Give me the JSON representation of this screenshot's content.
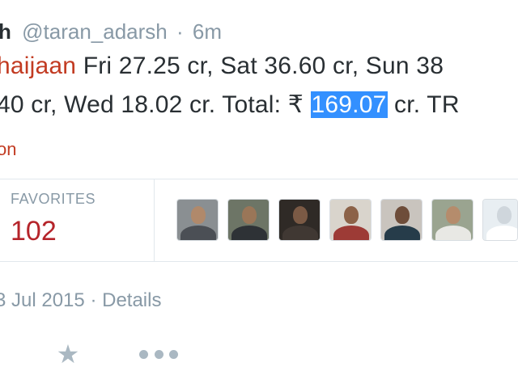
{
  "tweet": {
    "author_partial": "h",
    "handle": "@taran_adarsh",
    "separator": "·",
    "time": "6m",
    "line1": {
      "hashtag": "haijaan",
      "text": " Fri 27.25 cr, Sat 36.60 cr, Sun 38"
    },
    "line2": {
      "before": "40 cr, Wed 18.02 cr. Total: ₹ ",
      "highlighted": "169.07",
      "after": " cr. TR"
    },
    "link_partial": "on"
  },
  "stats": {
    "favorites_label": "FAVORITES",
    "favorites_count": "102"
  },
  "avatars": [
    {
      "name": "favoriter-1",
      "bg": "#8a8f92",
      "skin": "#b0896b",
      "shirt": "#4b4f55"
    },
    {
      "name": "favoriter-2",
      "bg": "#6d7566",
      "skin": "#9a7658",
      "shirt": "#2e3236"
    },
    {
      "name": "favoriter-3",
      "bg": "#2f2a26",
      "skin": "#7b5a45",
      "shirt": "#403833"
    },
    {
      "name": "favoriter-4",
      "bg": "#d9d4cc",
      "skin": "#8c6248",
      "shirt": "#9d3b36"
    },
    {
      "name": "favoriter-5",
      "bg": "#c9c4be",
      "skin": "#6e4d3a",
      "shirt": "#263c4a"
    },
    {
      "name": "favoriter-6",
      "bg": "#9aa490",
      "skin": "#b58c6c",
      "shirt": "#e8e8e4"
    },
    {
      "name": "favoriter-7",
      "bg": "#e8eef2",
      "skin": "#cfd6dc",
      "shirt": "#ffffff"
    }
  ],
  "meta": {
    "date": "3 Jul 2015",
    "separator": "·",
    "details_label": "Details"
  },
  "icons": {
    "favorite": "star-icon",
    "more": "more-dots-icon"
  },
  "colors": {
    "hashtag": "#c23b22",
    "favorites_count": "#b5242a",
    "selection": "#3390ff",
    "muted": "#8899a6"
  }
}
